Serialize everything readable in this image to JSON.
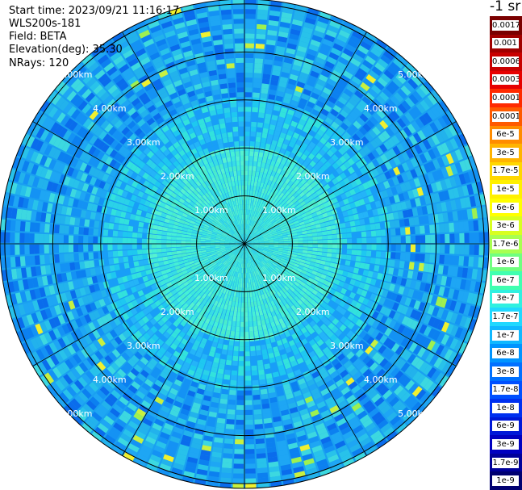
{
  "header": {
    "start_time": "Start time: 2023/09/21 11:16:17",
    "instrument": "WLS200s-181",
    "field": "Field: BETA",
    "elevation": "Elevation(deg): 35.30",
    "nrays": "NRays: 120"
  },
  "plot": {
    "range_ring_labels": [
      "1.00km",
      "2.00km",
      "3.00km",
      "4.00km",
      "5.00km"
    ],
    "max_range_km": 5.1,
    "n_rays": 120,
    "n_gates": 50
  },
  "colorbar": {
    "unit_label": "-1 sr",
    "labels": [
      "0.0017",
      "0.001",
      "0.0006",
      "0.0003",
      "0.00017",
      "0.0001",
      "6e-5",
      "3e-5",
      "1.7e-5",
      "1e-5",
      "6e-6",
      "3e-6",
      "1.7e-6",
      "1e-6",
      "6e-7",
      "3e-7",
      "1.7e-7",
      "1e-7",
      "6e-8",
      "3e-8",
      "1.7e-8",
      "1e-8",
      "6e-9",
      "3e-9",
      "1.7e-9",
      "1e-9"
    ],
    "colors": [
      "#7a0000",
      "#a00000",
      "#c80000",
      "#e60000",
      "#ff2a00",
      "#ff5a00",
      "#ff8c00",
      "#ffb400",
      "#ffd700",
      "#fff000",
      "#ffff00",
      "#d8ff20",
      "#a8ff50",
      "#70ff80",
      "#40ffb0",
      "#30f0e0",
      "#20d8ff",
      "#10b8ff",
      "#0094ff",
      "#0070ff",
      "#0050ff",
      "#0030f0",
      "#0018d8",
      "#0000c0",
      "#00009a",
      "#000070"
    ]
  }
}
